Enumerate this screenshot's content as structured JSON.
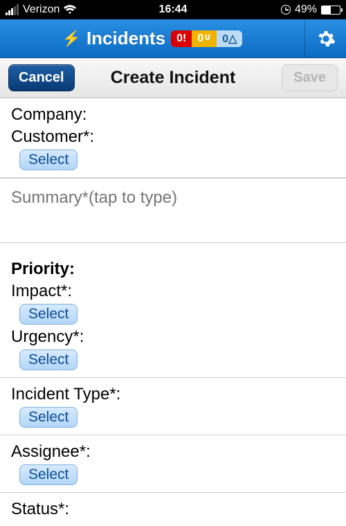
{
  "statusbar": {
    "carrier": "Verizon",
    "time": "16:44",
    "battery": "49%"
  },
  "header": {
    "title": "Incidents",
    "badge_red": "0!",
    "badge_orange": "0",
    "badge_blue": "0△"
  },
  "subheader": {
    "cancel": "Cancel",
    "title": "Create Incident",
    "save": "Save"
  },
  "form": {
    "company_label": "Company:",
    "customer_label": "Customer*:",
    "summary_placeholder": "Summary*(tap to type)",
    "priority_label": "Priority:",
    "impact_label": "Impact*:",
    "urgency_label": "Urgency*:",
    "incident_type_label": "Incident Type*:",
    "assignee_label": "Assignee*:",
    "status_label": "Status*:",
    "select_btn": "Select"
  }
}
